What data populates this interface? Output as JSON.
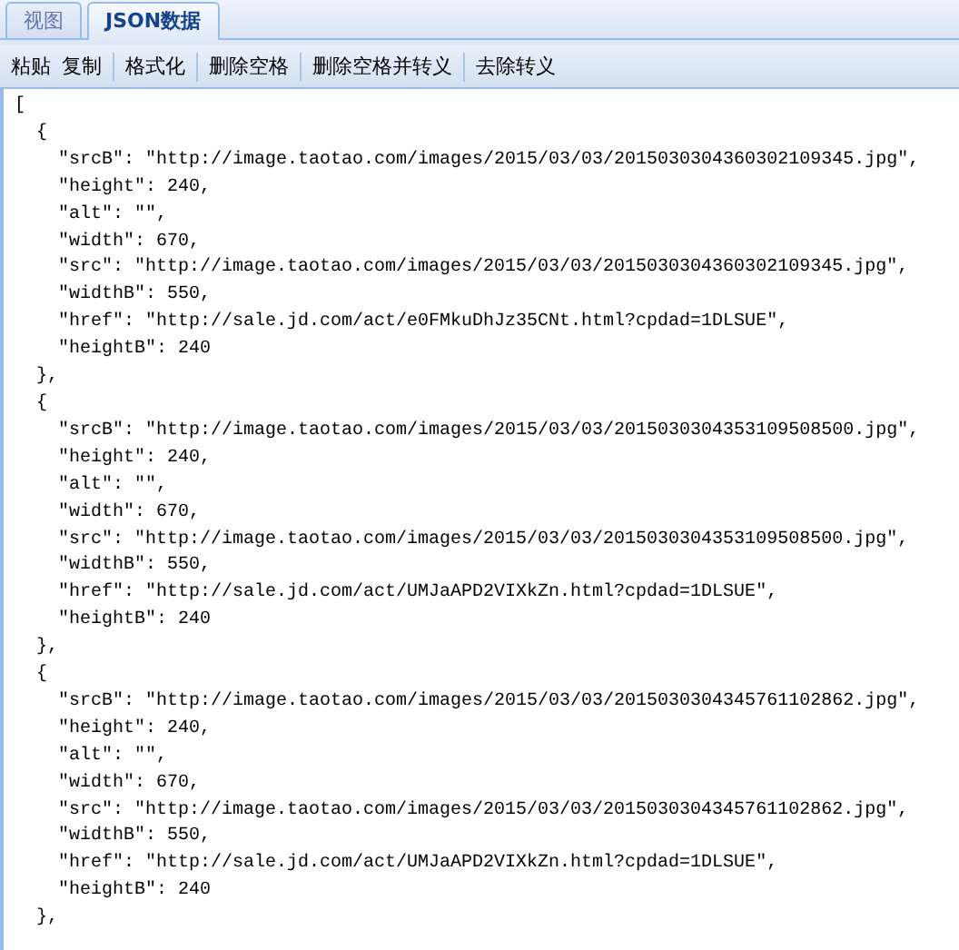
{
  "tabs": [
    {
      "label": "视图",
      "selected": false
    },
    {
      "label": "JSON数据",
      "selected": true
    }
  ],
  "toolbar": {
    "groups": [
      [
        "粘贴",
        "复制"
      ],
      [
        "格式化"
      ],
      [
        "删除空格"
      ],
      [
        "删除空格并转义"
      ],
      [
        "去除转义"
      ]
    ]
  },
  "editor": {
    "lines": [
      {
        "text": "[",
        "children": [
          {
            "text": "{",
            "children": [
              {
                "text": "\"srcB\": \"http://image.taotao.com/images/2015/03/03/2015030304360302109345.jpg\","
              },
              {
                "text": "\"height\": 240,"
              },
              {
                "text": "\"alt\": \"\","
              },
              {
                "text": "\"width\": 670,"
              },
              {
                "text": "\"src\": \"http://image.taotao.com/images/2015/03/03/2015030304360302109345.jpg\","
              },
              {
                "text": "\"widthB\": 550,"
              },
              {
                "text": "\"href\": \"http://sale.jd.com/act/e0FMkuDhJz35CNt.html?cpdad=1DLSUE\","
              },
              {
                "text": "\"heightB\": 240"
              }
            ]
          },
          {
            "text": "},"
          },
          {
            "text": "{",
            "children": [
              {
                "text": "\"srcB\": \"http://image.taotao.com/images/2015/03/03/2015030304353109508500.jpg\","
              },
              {
                "text": "\"height\": 240,"
              },
              {
                "text": "\"alt\": \"\","
              },
              {
                "text": "\"width\": 670,"
              },
              {
                "text": "\"src\": \"http://image.taotao.com/images/2015/03/03/2015030304353109508500.jpg\","
              },
              {
                "text": "\"widthB\": 550,"
              },
              {
                "text": "\"href\": \"http://sale.jd.com/act/UMJaAPD2VIXkZn.html?cpdad=1DLSUE\","
              },
              {
                "text": "\"heightB\": 240"
              }
            ]
          },
          {
            "text": "},"
          },
          {
            "text": "{",
            "children": [
              {
                "text": "\"srcB\": \"http://image.taotao.com/images/2015/03/03/2015030304345761102862.jpg\","
              },
              {
                "text": "\"height\": 240,"
              },
              {
                "text": "\"alt\": \"\","
              },
              {
                "text": "\"width\": 670,"
              },
              {
                "text": "\"src\": \"http://image.taotao.com/images/2015/03/03/2015030304345761102862.jpg\","
              },
              {
                "text": "\"widthB\": 550,"
              },
              {
                "text": "\"href\": \"http://sale.jd.com/act/UMJaAPD2VIXkZn.html?cpdad=1DLSUE\","
              },
              {
                "text": "\"heightB\": 240"
              }
            ]
          },
          {
            "text": "},"
          }
        ]
      }
    ]
  }
}
